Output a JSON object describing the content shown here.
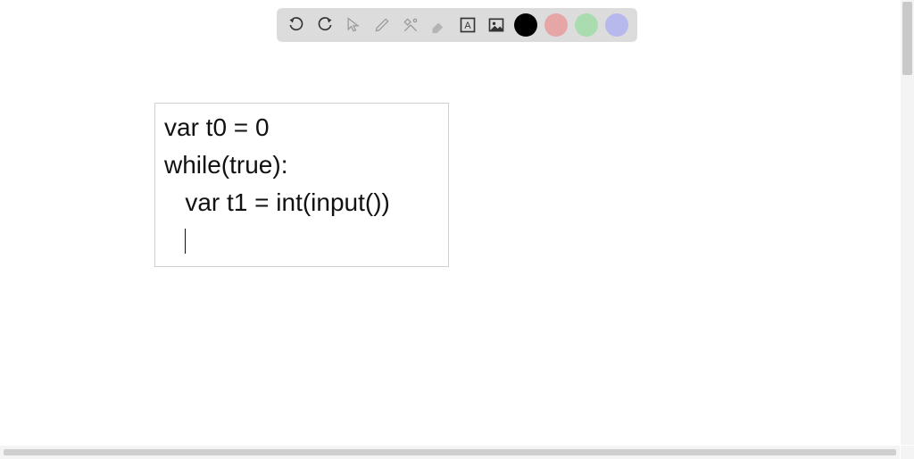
{
  "toolbar": {
    "colors": {
      "black": "#000000",
      "pink": "#e6a6a6",
      "green": "#a9dcae",
      "purple": "#b7b8ec"
    }
  },
  "textbox": {
    "line1": "var t0 = 0",
    "line2": "while(true):",
    "line3": "   var t1 = int(input())",
    "line4_indent": "   "
  }
}
